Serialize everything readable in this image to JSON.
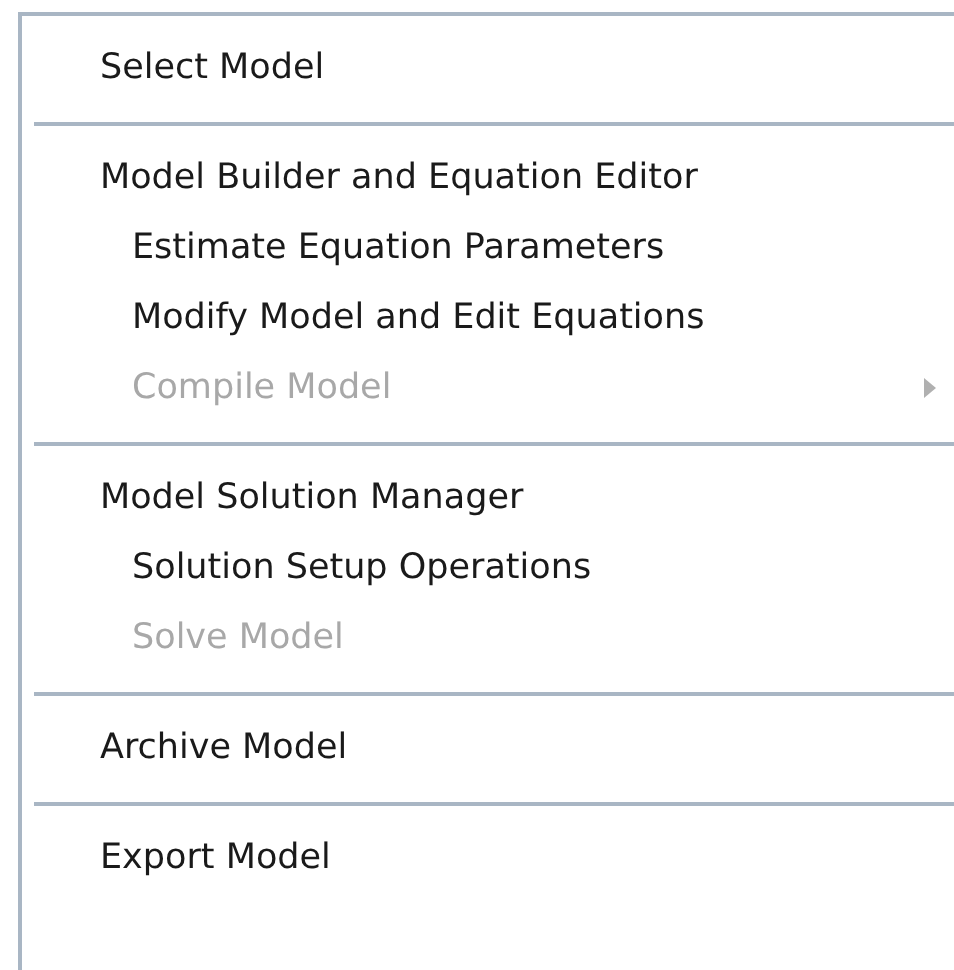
{
  "menu": {
    "sections": [
      {
        "items": [
          {
            "label": "Select Model",
            "disabled": false,
            "has_submenu": false
          }
        ]
      },
      {
        "items": [
          {
            "label": "Model Builder and Equation Editor",
            "disabled": false,
            "has_submenu": false,
            "children": [
              {
                "label": "Estimate Equation Parameters",
                "disabled": false,
                "has_submenu": false
              },
              {
                "label": "Modify Model and Edit Equations",
                "disabled": false,
                "has_submenu": false
              },
              {
                "label": "Compile Model",
                "disabled": true,
                "has_submenu": true
              }
            ]
          }
        ]
      },
      {
        "items": [
          {
            "label": "Model Solution Manager",
            "disabled": false,
            "has_submenu": false,
            "children": [
              {
                "label": "Solution Setup Operations",
                "disabled": false,
                "has_submenu": false
              },
              {
                "label": "Solve Model",
                "disabled": true,
                "has_submenu": false
              }
            ]
          }
        ]
      },
      {
        "items": [
          {
            "label": "Archive Model",
            "disabled": false,
            "has_submenu": false
          }
        ]
      },
      {
        "items": [
          {
            "label": "Export Model",
            "disabled": false,
            "has_submenu": false
          }
        ]
      }
    ]
  }
}
